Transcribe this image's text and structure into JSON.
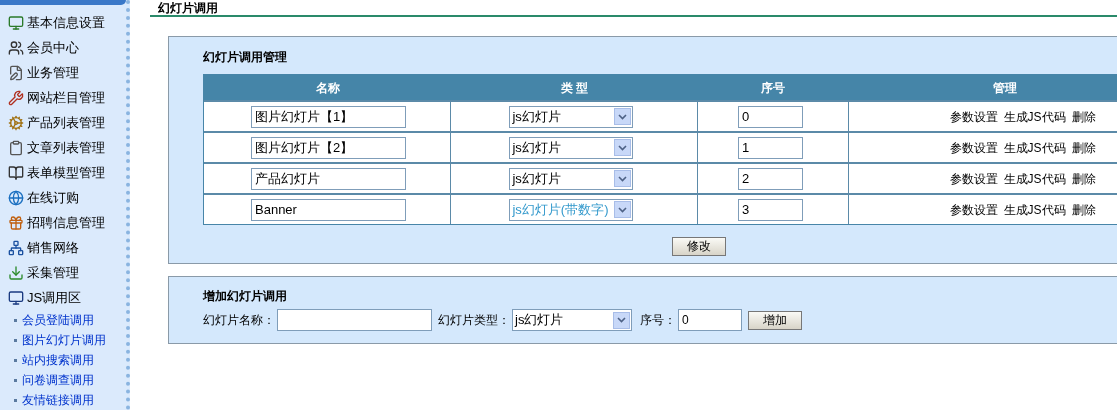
{
  "sidebar": {
    "items": [
      {
        "label": "基本信息设置"
      },
      {
        "label": "会员中心"
      },
      {
        "label": "业务管理"
      },
      {
        "label": "网站栏目管理"
      },
      {
        "label": "产品列表管理"
      },
      {
        "label": "文章列表管理"
      },
      {
        "label": "表单模型管理"
      },
      {
        "label": "在线订购"
      },
      {
        "label": "招聘信息管理"
      },
      {
        "label": "销售网络"
      },
      {
        "label": "采集管理"
      },
      {
        "label": "JS调用区",
        "children": [
          {
            "label": "会员登陆调用"
          },
          {
            "label": "图片幻灯片调用"
          },
          {
            "label": "站内搜索调用"
          },
          {
            "label": "问卷调查调用"
          },
          {
            "label": "友情链接调用"
          }
        ]
      }
    ]
  },
  "page_title": "幻灯片调用",
  "manage_panel": {
    "title": "幻灯片调用管理",
    "table": {
      "columns": [
        "名称",
        "类 型",
        "序号",
        "管理"
      ],
      "rows": [
        {
          "name": "图片幻灯片【1】",
          "type": "js幻灯片",
          "type_highlighted": false,
          "order": "0",
          "actions": [
            "参数设置",
            "生成JS代码",
            "删除"
          ]
        },
        {
          "name": "图片幻灯片【2】",
          "type": "js幻灯片",
          "type_highlighted": false,
          "order": "1",
          "actions": [
            "参数设置",
            "生成JS代码",
            "删除"
          ]
        },
        {
          "name": "产品幻灯片",
          "type": "js幻灯片",
          "type_highlighted": false,
          "order": "2",
          "actions": [
            "参数设置",
            "生成JS代码",
            "删除"
          ]
        },
        {
          "name": "Banner",
          "type": "js幻灯片(带数字)",
          "type_highlighted": true,
          "order": "3",
          "actions": [
            "参数设置",
            "生成JS代码",
            "删除"
          ]
        }
      ]
    },
    "button": "修改"
  },
  "add_panel": {
    "title": "增加幻灯片调用",
    "name_label": "幻灯片名称：",
    "type_label": "幻灯片类型：",
    "type_value": "js幻灯片",
    "order_label": "序号：",
    "order_value": "0",
    "button": "增加"
  }
}
